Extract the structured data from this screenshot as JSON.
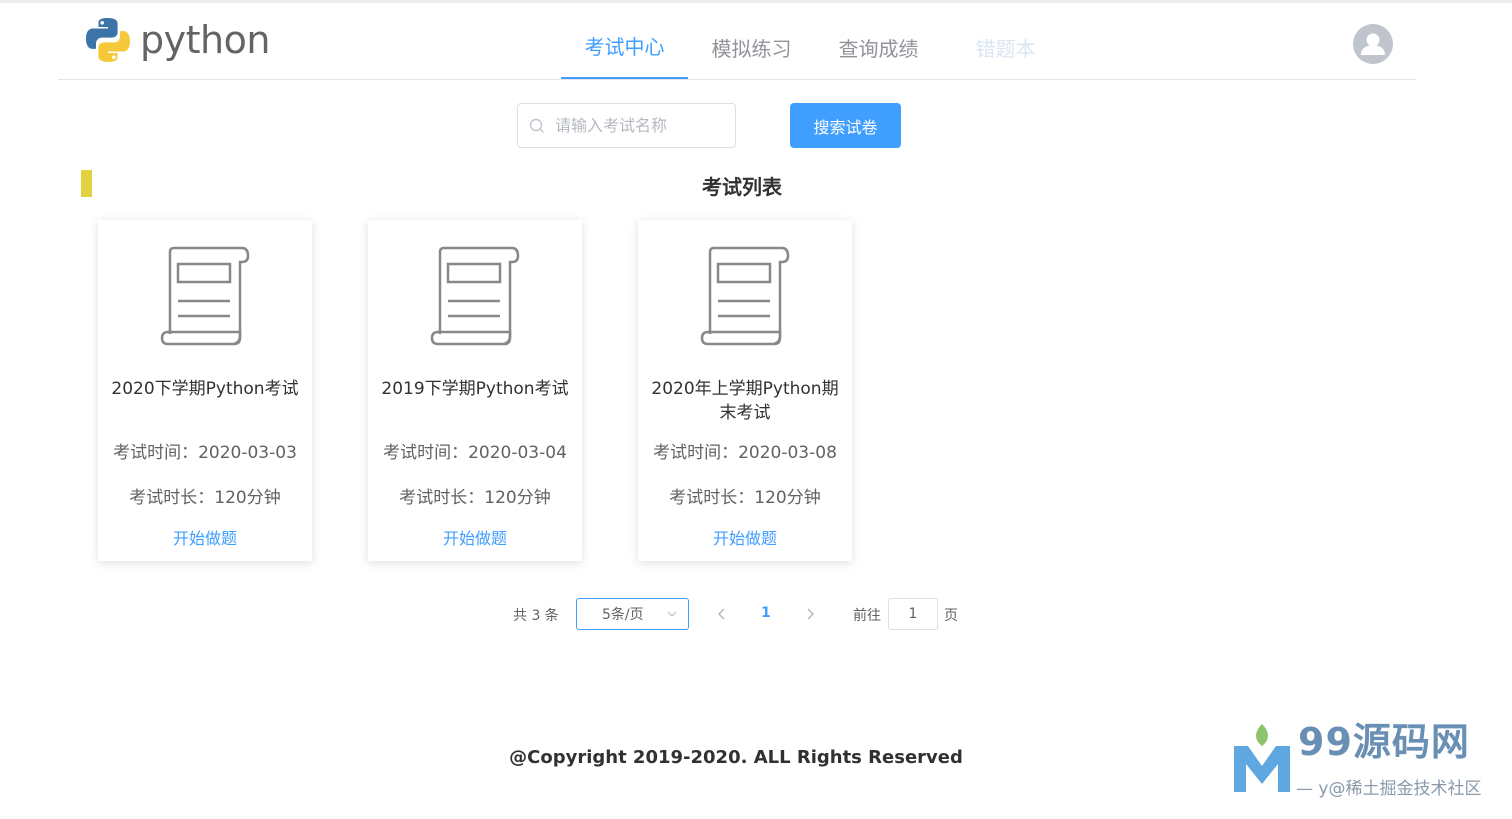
{
  "header": {
    "logo_text": "python",
    "nav": [
      {
        "label": "考试中心",
        "active": true
      },
      {
        "label": "模拟练习",
        "active": false
      },
      {
        "label": "查询成绩",
        "active": false
      },
      {
        "label": "错题本",
        "active": false
      }
    ]
  },
  "search": {
    "placeholder": "请输入考试名称",
    "button_label": "搜索试卷"
  },
  "section_title": "考试列表",
  "exams": [
    {
      "title": "2020下学期Python考试",
      "time": "考试时间：2020-03-03",
      "duration": "考试时长：120分钟",
      "action": "开始做题"
    },
    {
      "title": "2019下学期Python考试",
      "time": "考试时间：2020-03-04",
      "duration": "考试时长：120分钟",
      "action": "开始做题"
    },
    {
      "title": "2020年上学期Python期末考试",
      "time": "考试时间：2020-03-08",
      "duration": "考试时长：120分钟",
      "action": "开始做题"
    }
  ],
  "pagination": {
    "total_label": "共 3 条",
    "page_size": "5条/页",
    "current_page": "1",
    "goto_label": "前往",
    "goto_value": "1",
    "page_unit": "页"
  },
  "footer": "@Copyright 2019-2020. ALL Rights Reserved",
  "watermark": {
    "brand": "99源码网",
    "sub": "— y@稀土掘金技术社区"
  },
  "colors": {
    "primary": "#409EFF",
    "accent_bar": "#e2d23f",
    "python_blue": "#3d74a8",
    "python_yellow": "#f5c93a"
  }
}
